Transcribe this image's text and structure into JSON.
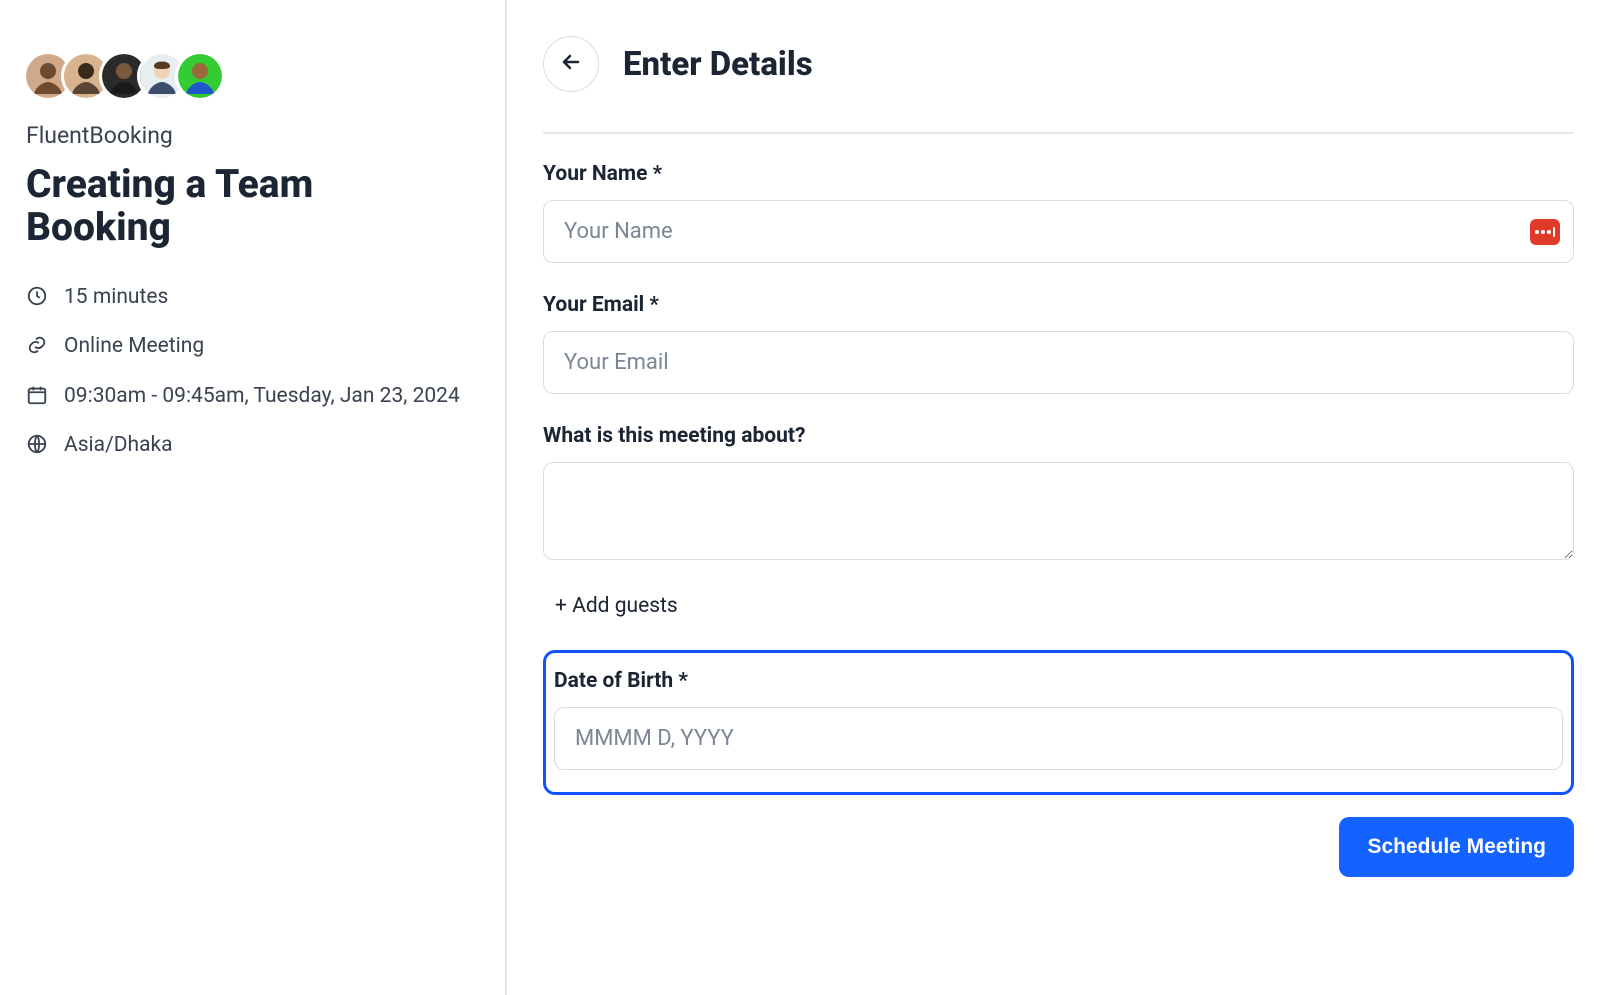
{
  "summary": {
    "org": "FluentBooking",
    "title": "Creating a Team Booking",
    "duration": "15 minutes",
    "location": "Online Meeting",
    "datetime": "09:30am - 09:45am, Tuesday, Jan 23, 2024",
    "timezone": "Asia/Dhaka",
    "avatars": [
      {
        "name": "avatar-1",
        "bg": "#cfa98a"
      },
      {
        "name": "avatar-2",
        "bg": "#d7b48e"
      },
      {
        "name": "avatar-3",
        "bg": "#2a2a2a"
      },
      {
        "name": "avatar-4",
        "bg": "#e7eef2"
      },
      {
        "name": "avatar-5",
        "bg": "#33cc33"
      }
    ]
  },
  "form": {
    "heading": "Enter Details",
    "back_icon": "arrow-left",
    "fields": {
      "name": {
        "label": "Your Name *",
        "placeholder": "Your Name",
        "value": ""
      },
      "email": {
        "label": "Your Email *",
        "placeholder": "Your Email",
        "value": ""
      },
      "topic": {
        "label": "What is this meeting about?",
        "placeholder": "",
        "value": ""
      },
      "dob": {
        "label": "Date of Birth *",
        "placeholder": "MMMM D, YYYY",
        "value": ""
      }
    },
    "add_guests": "+ Add guests",
    "submit": "Schedule Meeting",
    "autofill_badge_icon": "password-autofill"
  }
}
